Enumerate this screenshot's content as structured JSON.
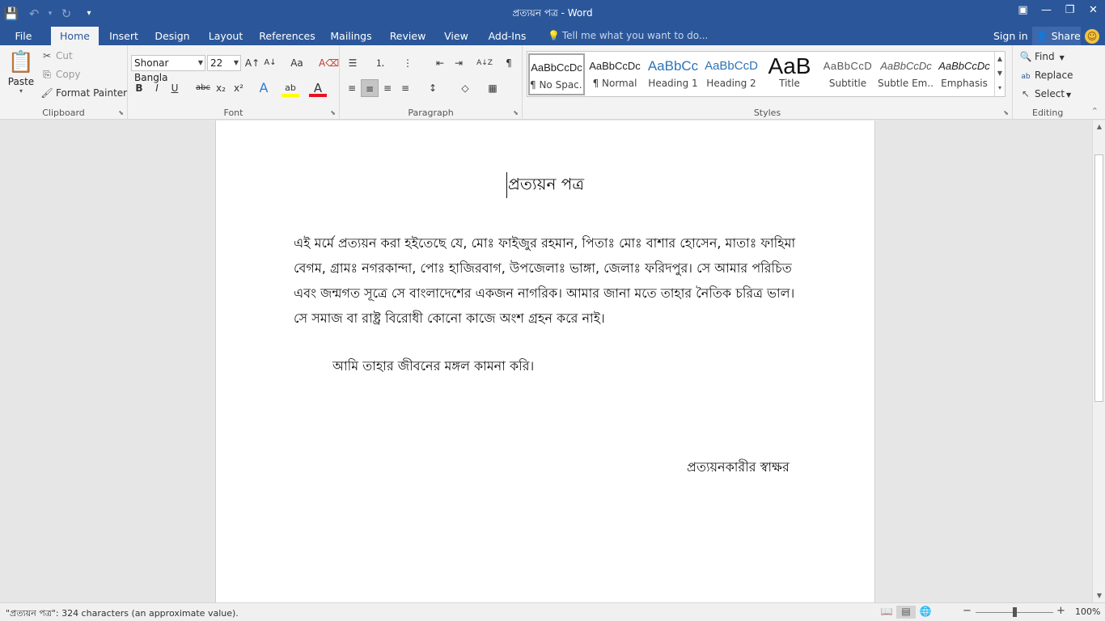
{
  "window": {
    "title": "প্রত্যয়ন  পত্র - Word",
    "controls": {
      "ribbon_display": "▣",
      "minimize": "—",
      "restore": "❐",
      "close": "✕"
    }
  },
  "qat": {
    "save_icon": "💾",
    "undo_icon": "↶",
    "undo_arrow": "▾",
    "redo_icon": "↻",
    "customize_icon": "▾"
  },
  "tabs": [
    {
      "label": "File"
    },
    {
      "label": "Home"
    },
    {
      "label": "Insert"
    },
    {
      "label": "Design"
    },
    {
      "label": "Layout"
    },
    {
      "label": "References"
    },
    {
      "label": "Mailings"
    },
    {
      "label": "Review"
    },
    {
      "label": "View"
    },
    {
      "label": "Add-Ins"
    }
  ],
  "tellme": {
    "placeholder": "Tell me what you want to do...",
    "icon": "💡"
  },
  "account": {
    "signin": "Sign in",
    "share": "Share",
    "share_icon": "👤",
    "smiley": "☺"
  },
  "clipboard": {
    "paste": "Paste",
    "cut": "Cut",
    "copy": "Copy",
    "format_painter": "Format Painter",
    "label": "Clipboard",
    "icons": {
      "paste": "📋",
      "cut": "✂",
      "copy": "⎘",
      "painter": "🖌",
      "launcher": "⬊"
    }
  },
  "font": {
    "name": "Shonar Bangla",
    "size": "22",
    "label": "Font",
    "buttons": {
      "bold": "B",
      "italic": "I",
      "underline": "U",
      "strike": "abc",
      "sub": "x₂",
      "sup": "x²",
      "grow": "A↑",
      "shrink": "A↓",
      "case": "Aa",
      "clear": "A⌫",
      "effects": "A",
      "highlight": "ab",
      "color": "A"
    }
  },
  "paragraph": {
    "label": "Paragraph",
    "buttons": {
      "bullets": "☰",
      "numbering": "⒈",
      "multilevel": "⋮",
      "decrease": "⇤",
      "increase": "⇥",
      "sort": "A↓Z",
      "pilcrow": "¶",
      "left": "≡",
      "center": "≡",
      "right": "≡",
      "justify": "≡",
      "spacing": "↕",
      "shading": "◇",
      "borders": "▦"
    }
  },
  "styles": {
    "label": "Styles",
    "items": [
      {
        "preview": "AaBbCcDc",
        "name": "¶ No Spac..."
      },
      {
        "preview": "AaBbCcDc",
        "name": "¶ Normal"
      },
      {
        "preview": "AaBbCc",
        "name": "Heading 1"
      },
      {
        "preview": "AaBbCcD",
        "name": "Heading 2"
      },
      {
        "preview": "AaB",
        "name": "Title"
      },
      {
        "preview": "AaBbCcD",
        "name": "Subtitle"
      },
      {
        "preview": "AaBbCcDc",
        "name": "Subtle Em..."
      },
      {
        "preview": "AaBbCcDc",
        "name": "Emphasis"
      }
    ],
    "colors": {
      "heading": "#2e74b5",
      "title": "#111111",
      "subtle": "#595959"
    }
  },
  "editing": {
    "label": "Editing",
    "find": "Find",
    "replace": "Replace",
    "select": "Select",
    "icons": {
      "find": "🔍",
      "replace": "ab",
      "select": "↖",
      "collapse": "⌃"
    }
  },
  "document": {
    "title": "প্রত্যয়ন পত্র",
    "paragraph": "এই মর্মে প্রত্যয়ন করা হইতেছে যে, মোঃ ফাইজুর রহমান, পিতাঃ মোঃ বাশার হোসেন, মাতাঃ ফাহিমা বেগম, গ্রামঃ নগরকান্দা, পোঃ হাজিরবাগ, উপজেলাঃ ভাঙ্গা, জেলাঃ ফরিদপুর। সে আমার পরিচিত এবং জন্মগত সূত্রে সে বাংলাদেশের একজন নাগরিক। আমার জানা মতে তাহার নৈতিক চরিত্র ভাল। সে সমাজ বা রাষ্ট্র বিরোধী কোনো কাজে অংশ গ্রহন করে নাই।",
    "wish": "আমি তাহার জীবনের মঙ্গল কামনা করি।",
    "signature": "প্রত্যয়নকারীর স্বাক্ষর"
  },
  "status": {
    "text": "\"প্রত্যয়ন  পত্র\": 324  characters (an approximate value).",
    "zoom": "100%",
    "zoom_fraction": 0.5,
    "views": {
      "read": "📖",
      "print": "▤",
      "web": "🌐"
    }
  },
  "colors": {
    "brand": "#2b579a",
    "ribbon": "#f3f3f3",
    "canvas": "#e6e6e6"
  }
}
